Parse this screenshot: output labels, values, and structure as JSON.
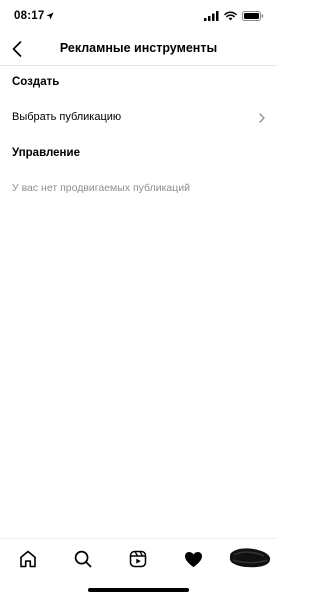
{
  "status_bar": {
    "time": "08:17",
    "icons": [
      "location-arrow-icon",
      "signal-icon",
      "wifi-icon",
      "battery-icon"
    ]
  },
  "header": {
    "title": "Рекламные инструменты",
    "back_icon": "chevron-left-icon"
  },
  "create_section": {
    "title": "Создать",
    "items": [
      {
        "label": "Выбрать публикацию",
        "icon": "chevron-right-icon"
      }
    ]
  },
  "manage_section": {
    "title": "Управление",
    "empty_text": "У вас нет продвигаемых публикаций"
  },
  "tab_bar": {
    "items": [
      "home-icon",
      "search-icon",
      "reels-icon",
      "heart-icon",
      "profile-avatar"
    ]
  },
  "colors": {
    "text": "#000000",
    "muted": "#8e8e8e",
    "divider": "#e6e6e6"
  }
}
